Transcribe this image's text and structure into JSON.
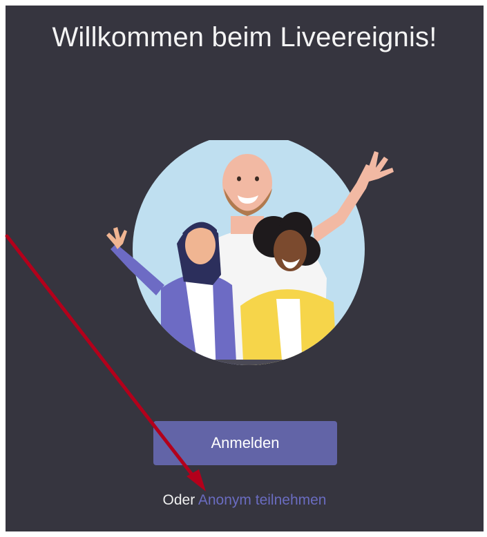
{
  "welcome": {
    "title": "Willkommen beim Liveereignis!"
  },
  "actions": {
    "signin_label": "Anmelden",
    "alt_prefix": "Oder",
    "anonymous_link": "Anonym teilnehmen"
  },
  "illustration": {
    "description_icon": "people-waving-illustration"
  },
  "colors": {
    "panel_background": "#36353f",
    "button": "#6264a7",
    "link": "#6a6cc0",
    "annotation_arrow": "#b3001b"
  }
}
